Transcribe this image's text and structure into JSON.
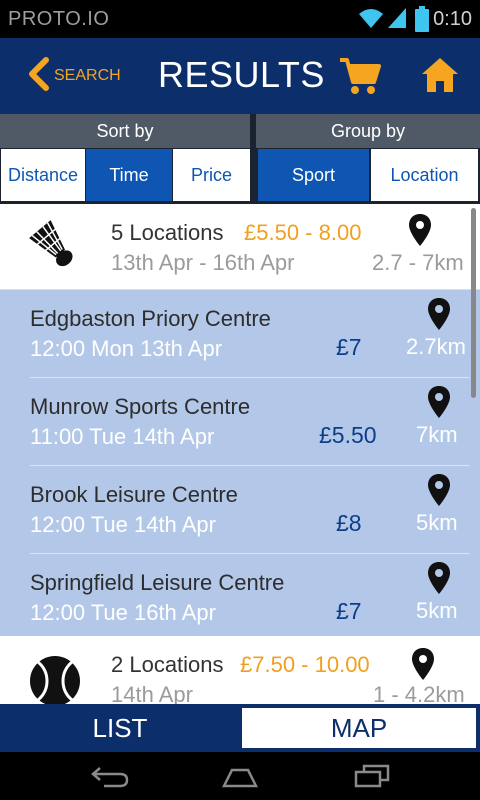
{
  "status_bar": {
    "carrier": "PROTO.IO",
    "time": "0:10",
    "icons": [
      "wifi-icon",
      "signal-icon",
      "battery-icon"
    ]
  },
  "header": {
    "back_label": "SEARCH",
    "title": "RESULTS",
    "icons": [
      "chevron-left-icon",
      "cart-icon",
      "home-icon"
    ]
  },
  "sort": {
    "heading": "Sort by",
    "options": [
      "Distance",
      "Time",
      "Price"
    ],
    "selected": "Time"
  },
  "group": {
    "heading": "Group by",
    "options": [
      "Sport",
      "Location"
    ],
    "selected": "Sport"
  },
  "results": [
    {
      "sport_icon": "shuttlecock-icon",
      "count_label": "5 Locations",
      "price_range": "£5.50 - 8.00",
      "date_range": "13th Apr - 16th Apr",
      "distance_range": "2.7 - 7km",
      "venues": [
        {
          "name": "Edgbaston Priory Centre",
          "when": "12:00 Mon 13th Apr",
          "price": "£7",
          "distance": "2.7km"
        },
        {
          "name": "Munrow Sports Centre",
          "when": "11:00 Tue 14th Apr",
          "price": "£5.50",
          "distance": "7km"
        },
        {
          "name": "Brook Leisure Centre",
          "when": "12:00 Tue 14th Apr",
          "price": "£8",
          "distance": "5km"
        },
        {
          "name": "Springfield Leisure Centre",
          "when": "12:00 Tue 16th Apr",
          "price": "£7",
          "distance": "5km"
        }
      ]
    },
    {
      "sport_icon": "tennis-ball-icon",
      "count_label": "2 Locations",
      "price_range": "£7.50 - 10.00",
      "date_range": "14th Apr",
      "distance_range": "1 - 4.2km"
    }
  ],
  "tabs": {
    "list_label": "LIST",
    "map_label": "MAP"
  },
  "colors": {
    "header_blue": "#0c2f6c",
    "accent_orange": "#f5a51f",
    "selected_blue": "#0e56b2",
    "venue_bg": "#b3c8e8"
  }
}
